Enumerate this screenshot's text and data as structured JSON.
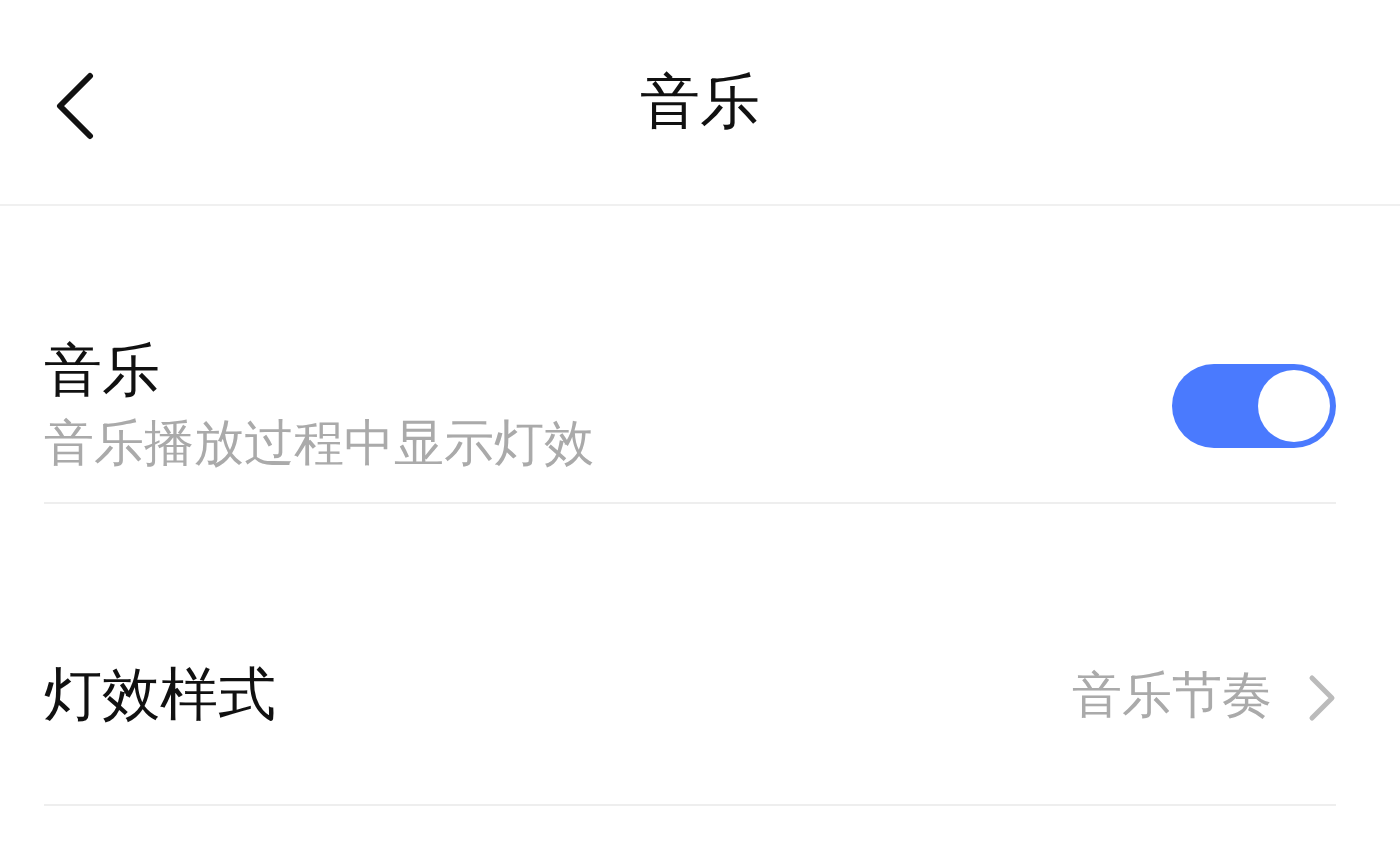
{
  "header": {
    "title": "音乐"
  },
  "settings": [
    {
      "kind": "toggle",
      "label": "音乐",
      "description": "音乐播放过程中显示灯效",
      "on": true
    },
    {
      "kind": "link",
      "label": "灯效样式",
      "value": "音乐节奏"
    }
  ]
}
